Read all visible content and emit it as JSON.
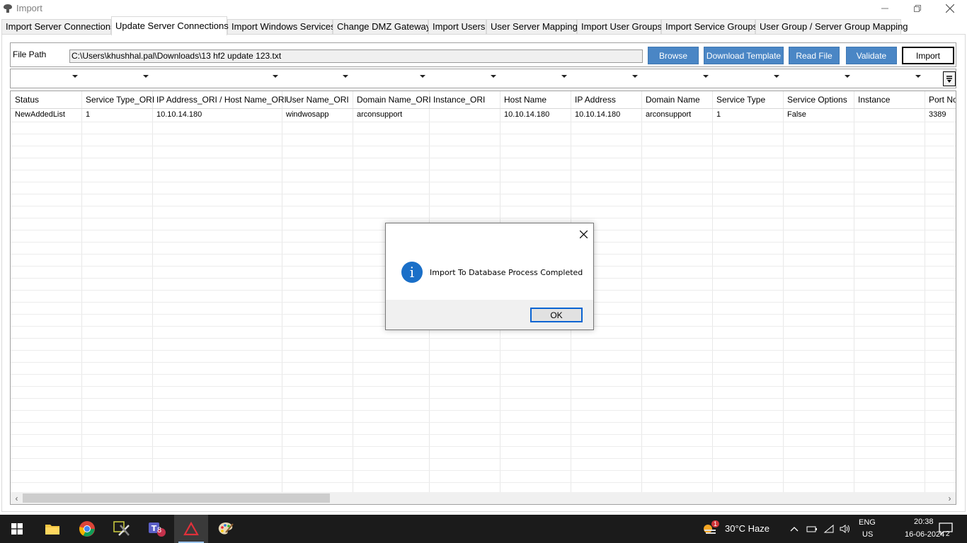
{
  "window": {
    "title": "Import"
  },
  "tabs": [
    {
      "label": "Import Server Connections"
    },
    {
      "label": "Update Server Connections"
    },
    {
      "label": "Import Windows Services"
    },
    {
      "label": "Change DMZ Gateway"
    },
    {
      "label": "Import Users"
    },
    {
      "label": "User Server Mapping"
    },
    {
      "label": "Import User Groups"
    },
    {
      "label": "Import Service Groups"
    },
    {
      "label": "User Group / Server Group Mapping"
    }
  ],
  "file_panel": {
    "label": "File Path",
    "path_value": "C:\\Users\\khushhal.pal\\Downloads\\13 hf2 update 123.txt",
    "browse": "Browse",
    "download_template": "Download Template",
    "read_file": "Read File",
    "validate": "Validate",
    "import": "Import"
  },
  "grid": {
    "columns": [
      "Status",
      "Service Type_ORI",
      "IP Address_ORI / Host Name_ORI",
      "User Name_ORI",
      "Domain Name_ORI",
      "Instance_ORI",
      "Host Name",
      "IP Address",
      "Domain Name",
      "Service Type",
      "Service Options",
      "Instance",
      "Port No"
    ],
    "rows": [
      [
        "NewAddedList",
        "1",
        "10.10.14.180",
        "windwosapp",
        "arconsupport",
        "",
        "10.10.14.180",
        "10.10.14.180",
        "arconsupport",
        "1",
        "False",
        "",
        "3389"
      ]
    ]
  },
  "dialog": {
    "message": "Import To Database Process Completed",
    "ok": "OK",
    "icon": "info-icon"
  },
  "taskbar": {
    "weather_badge": "1",
    "weather": "30°C  Haze",
    "lang_top": "ENG",
    "lang_bottom": "US",
    "time": "20:38",
    "date": "16-06-2024",
    "teams_badge": "8",
    "notification_count": "2"
  },
  "colors": {
    "accent": "#4a86c5",
    "dialog_icon": "#1a6fc8",
    "taskbar": "#1b1b1b"
  }
}
